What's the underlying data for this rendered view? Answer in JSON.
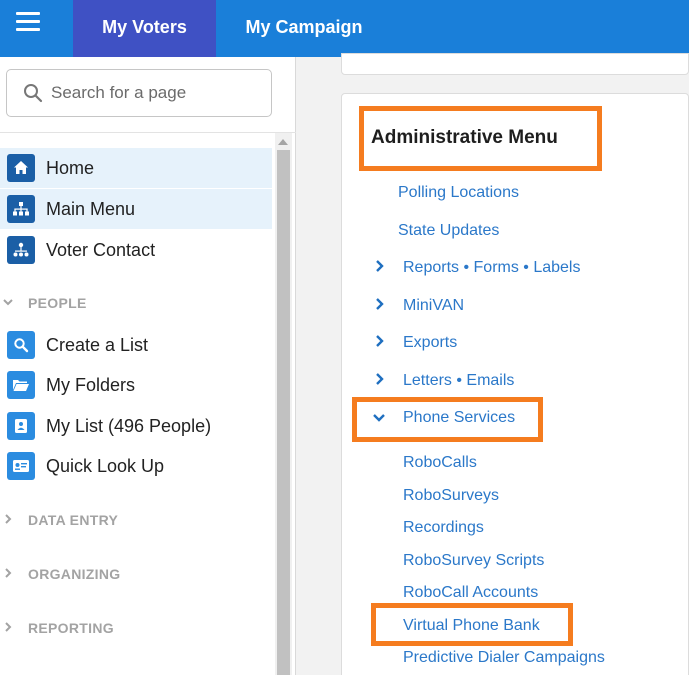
{
  "header": {
    "tabs": [
      {
        "label": "My Voters",
        "active": true
      },
      {
        "label": "My Campaign",
        "active": false
      }
    ],
    "active_color": "#3f51c4",
    "bar_color": "#1a7fd9"
  },
  "sidebar": {
    "search": {
      "placeholder": "Search for a page",
      "value": ""
    },
    "top_items": [
      {
        "label": "Home",
        "icon": "home-icon"
      },
      {
        "label": "Main Menu",
        "icon": "sitemap-icon"
      },
      {
        "label": "Voter Contact",
        "icon": "network-icon"
      }
    ],
    "sections": [
      {
        "label": "PEOPLE",
        "expanded": true
      },
      {
        "label": "DATA ENTRY",
        "expanded": false
      },
      {
        "label": "ORGANIZING",
        "expanded": false
      },
      {
        "label": "REPORTING",
        "expanded": false
      }
    ],
    "people_items": [
      {
        "label": "Create a List",
        "icon": "search-icon"
      },
      {
        "label": "My Folders",
        "icon": "folder-icon"
      },
      {
        "label": "My List (496 People)",
        "icon": "contact-card-icon"
      },
      {
        "label": "Quick Look Up",
        "icon": "id-card-icon"
      }
    ]
  },
  "admin_menu": {
    "title": "Administrative Menu",
    "items": [
      {
        "label": "Polling Locations"
      },
      {
        "label": "State Updates"
      },
      {
        "label": "Reports • Forms • Labels"
      },
      {
        "label": "MiniVAN"
      },
      {
        "label": "Exports"
      },
      {
        "label": "Letters • Emails"
      },
      {
        "label": "Phone Services"
      }
    ],
    "phone_services_items": [
      {
        "label": "RoboCalls"
      },
      {
        "label": "RoboSurveys"
      },
      {
        "label": "Recordings"
      },
      {
        "label": "RoboSurvey Scripts"
      },
      {
        "label": "RoboCall Accounts"
      },
      {
        "label": "Virtual Phone Bank"
      },
      {
        "label": "Predictive Dialer Campaigns"
      }
    ],
    "highlight_color": "#f57c1f",
    "link_color": "#2b78c9"
  }
}
